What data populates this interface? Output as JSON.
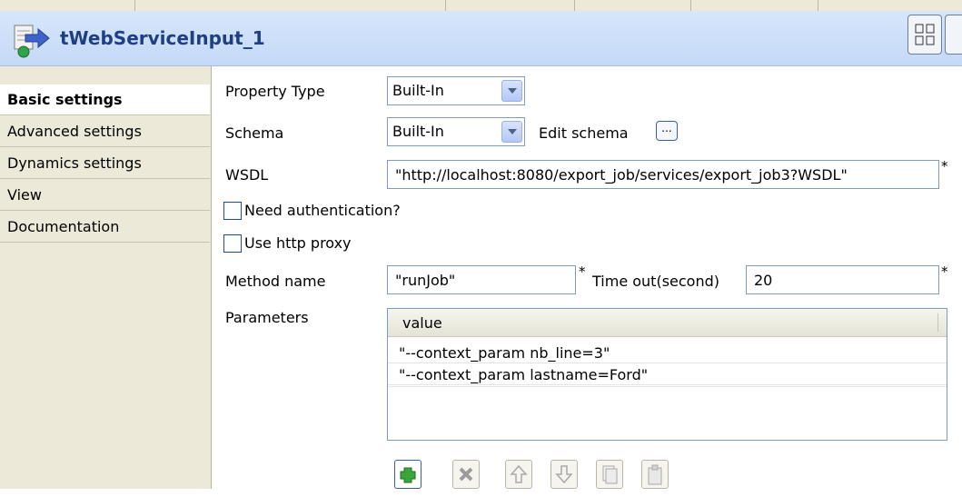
{
  "component": {
    "title": "tWebServiceInput_1",
    "icon": "web-service-input-icon"
  },
  "sidebar": {
    "items": [
      {
        "label": "Basic settings",
        "active": true
      },
      {
        "label": "Advanced settings"
      },
      {
        "label": "Dynamics settings"
      },
      {
        "label": "View"
      },
      {
        "label": "Documentation"
      }
    ]
  },
  "form": {
    "property_type": {
      "label": "Property Type",
      "value": "Built-In"
    },
    "schema": {
      "label": "Schema",
      "value": "Built-In",
      "edit_label": "Edit schema",
      "edit_button": "..."
    },
    "wsdl": {
      "label": "WSDL",
      "value": "\"http://localhost:8080/export_job/services/export_job3?WSDL\"",
      "required": "*"
    },
    "need_auth": {
      "label": "Need authentication?",
      "checked": false
    },
    "use_proxy": {
      "label": "Use http proxy",
      "checked": false
    },
    "method": {
      "label": "Method name",
      "value": "\"runJob\"",
      "required": "*"
    },
    "timeout": {
      "label": "Time out(second)",
      "value": "20",
      "required": "*"
    },
    "parameters": {
      "label": "Parameters",
      "column": "value",
      "rows": [
        "\"--context_param nb_line=3\"",
        "\"--context_param lastname=Ford\""
      ]
    }
  },
  "toolbar": {
    "buttons": [
      "add-icon",
      "remove-icon",
      "move-up-icon",
      "move-down-icon",
      "copy-icon",
      "paste-icon"
    ]
  },
  "colors": {
    "header_title": "#1f3f85",
    "header_bg": "#c4d9f7",
    "sidebar_bg": "#ece9d8",
    "add_green": "#2e9a2e"
  }
}
